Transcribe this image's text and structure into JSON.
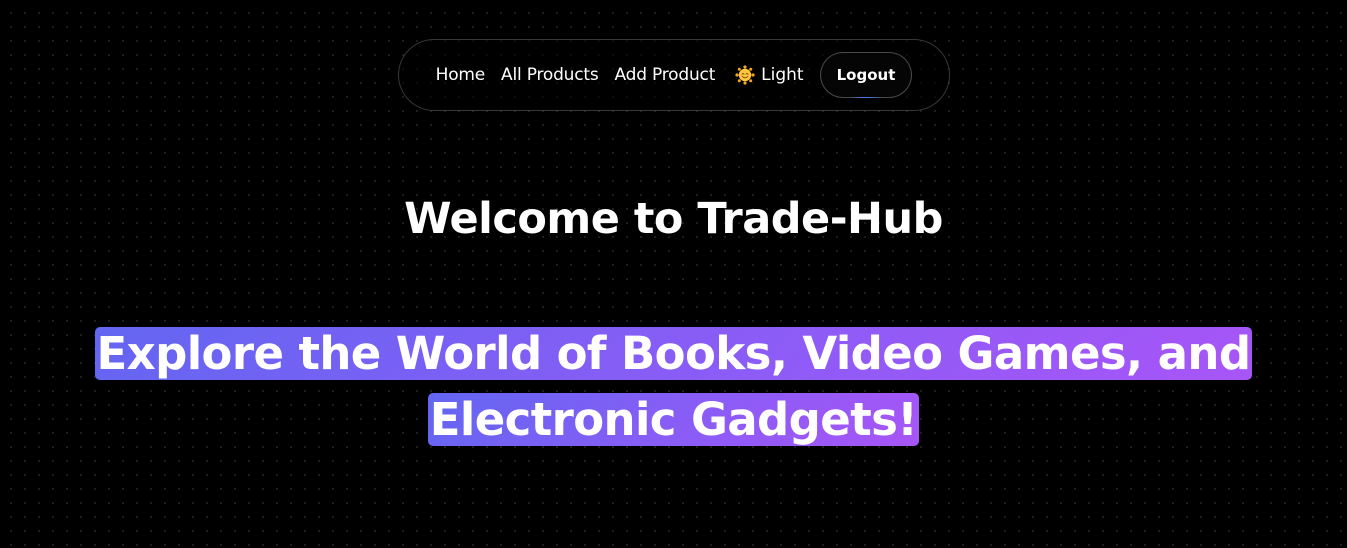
{
  "nav": {
    "home_label": "Home",
    "all_products_label": "All Products",
    "add_product_label": "Add Product",
    "theme_label": "Light",
    "theme_icon": "sun-face-icon",
    "logout_label": "Logout"
  },
  "hero": {
    "title": "Welcome to Trade-Hub",
    "tagline": "Explore the World of Books, Video Games, and Electronic Gadgets!"
  },
  "colors": {
    "background": "#000000",
    "gradient_start": "#6366f1",
    "gradient_end": "#a855f7",
    "logout_glow": "#4f7cff"
  }
}
